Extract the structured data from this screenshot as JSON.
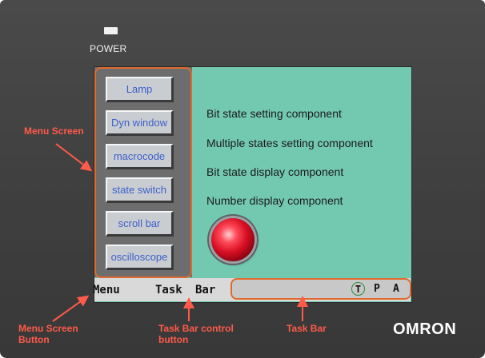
{
  "device": {
    "power_label": "POWER",
    "brand": "OMRON"
  },
  "menu": {
    "buttons": [
      "Lamp",
      "Dyn window",
      "macrocode",
      "state switch",
      "scroll bar",
      "oscilloscope"
    ]
  },
  "components": [
    "Bit state setting component",
    "Multiple states setting component",
    "Bit state display component",
    "Number display component"
  ],
  "taskbar": {
    "menu_label": "Menu",
    "task_label": "Task",
    "bar_label": "Bar",
    "icons": [
      "T",
      "P",
      "A"
    ]
  },
  "annotations": {
    "menu_screen": "Menu Screen",
    "menu_screen_button": "Menu Screen Button",
    "taskbar_control_button": "Task Bar control button",
    "task_bar": "Task Bar"
  },
  "colors": {
    "screen_bg": "#73c9b0",
    "annotation": "#ff5a4a",
    "outline": "#e06a2e",
    "button_text": "#3d5fc9"
  }
}
